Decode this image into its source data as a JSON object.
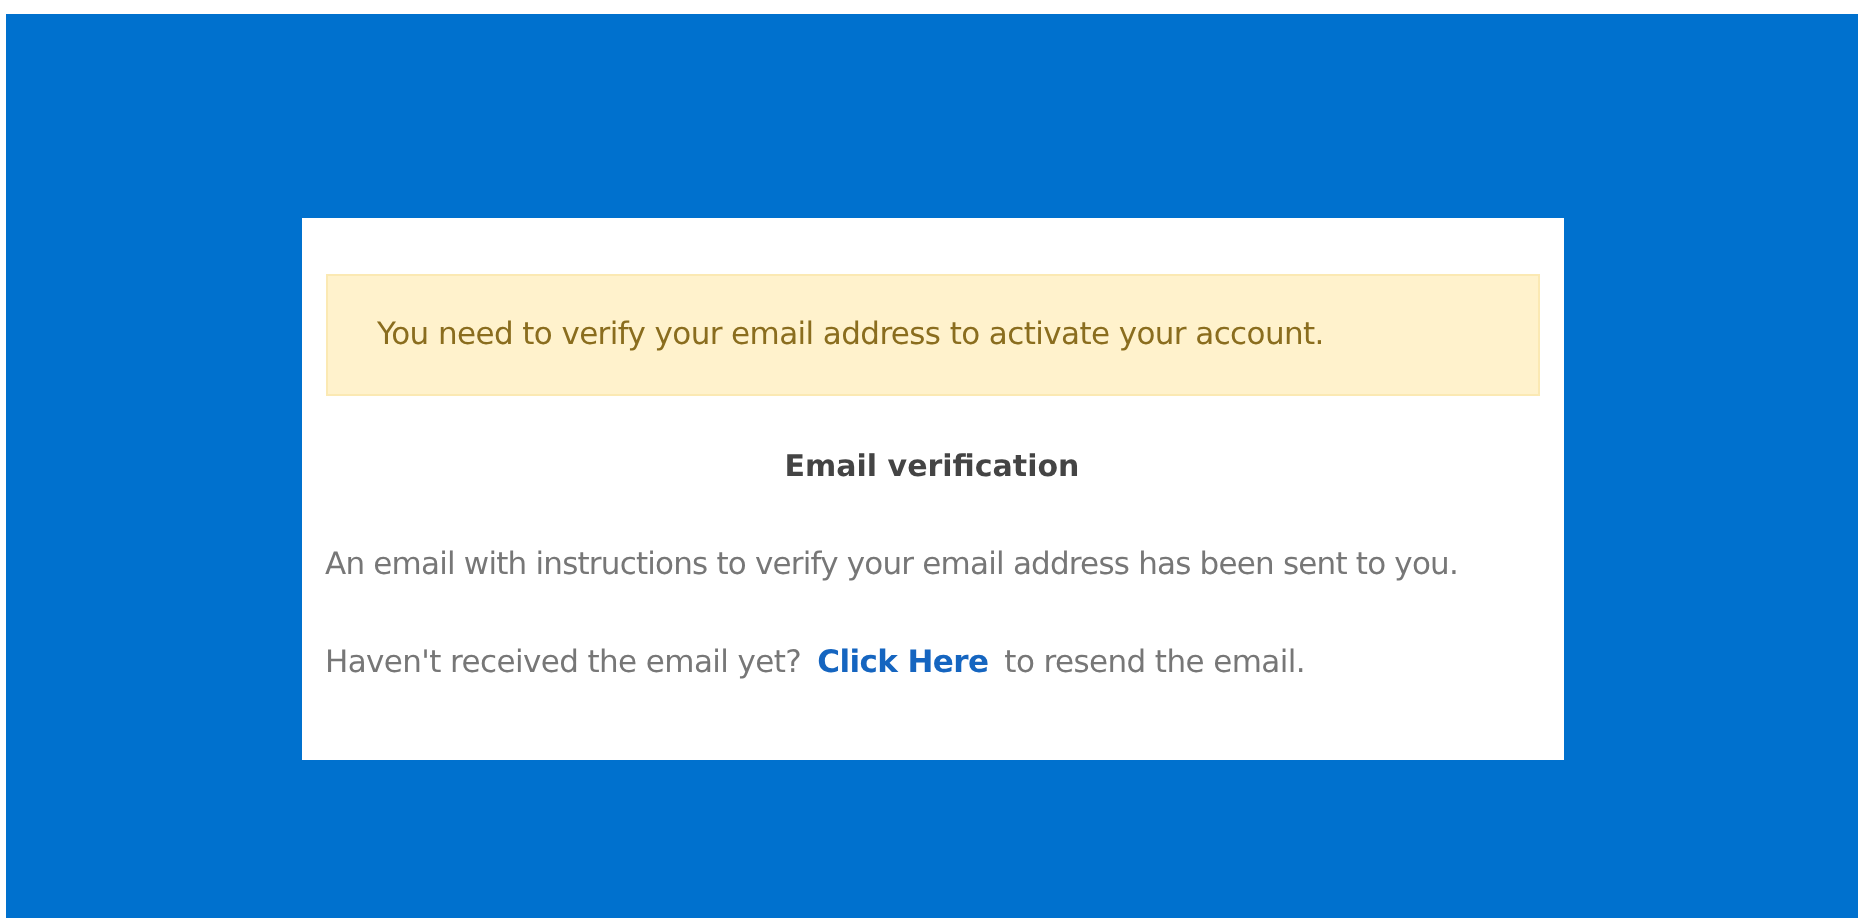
{
  "alert": {
    "text": "You need to verify your email address to activate your account."
  },
  "heading": "Email verification",
  "message": "An email with instructions to verify your email address has been sent to you.",
  "resend": {
    "before": "Haven't received the email yet?",
    "link": "Click Here",
    "after": "to resend the email."
  }
}
